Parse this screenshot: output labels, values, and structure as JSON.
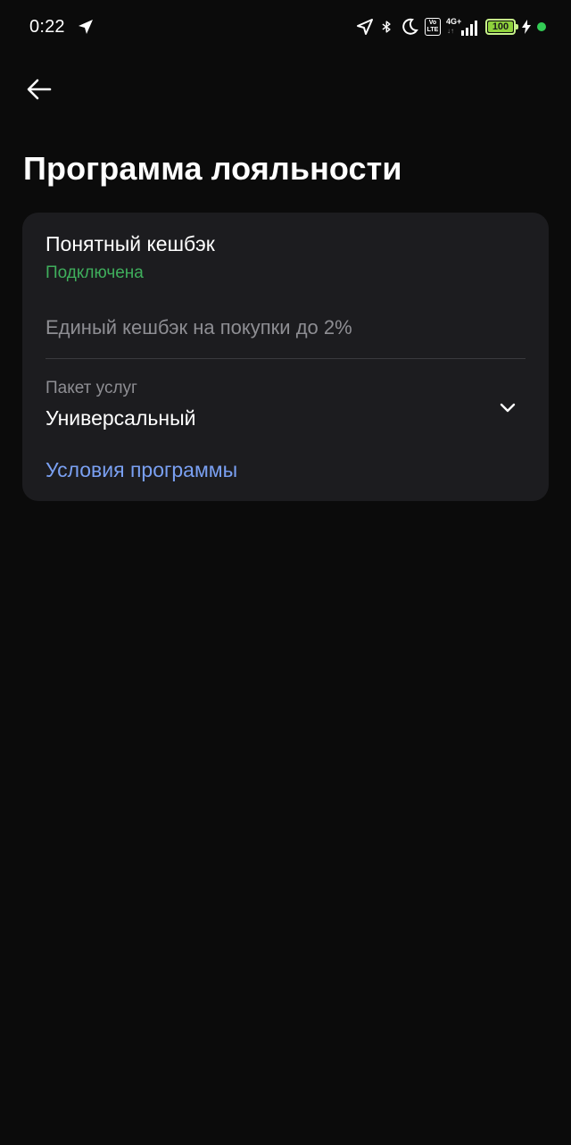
{
  "status_bar": {
    "time": "0:22",
    "volte_top": "Vo",
    "volte_bottom": "LTE",
    "network_type": "4G+",
    "network_arrows": "↓↑",
    "battery_level": "100",
    "colors": {
      "battery": "#8fd23c",
      "dot": "#33cc55"
    },
    "icons": [
      "navigation-icon",
      "location-arrow-icon",
      "bluetooth-icon",
      "moon-icon",
      "volte-icon",
      "signal-icon",
      "battery-icon",
      "charging-icon",
      "green-dot-icon"
    ]
  },
  "header": {
    "back_icon": "arrow-left-icon",
    "title": "Программа лояльности"
  },
  "card": {
    "program_name": "Понятный кешбэк",
    "status": "Подключена",
    "description": "Единый кешбэк на покупки до 2%",
    "package": {
      "label": "Пакет услуг",
      "value": "Универсальный",
      "icon": "chevron-down-icon"
    },
    "terms_link": "Условия программы"
  },
  "colors": {
    "background": "#0b0b0b",
    "card": "#1c1c1f",
    "status_green": "#3fae5c",
    "link_blue": "#7aa0f2",
    "muted_text": "#8e8e93"
  }
}
